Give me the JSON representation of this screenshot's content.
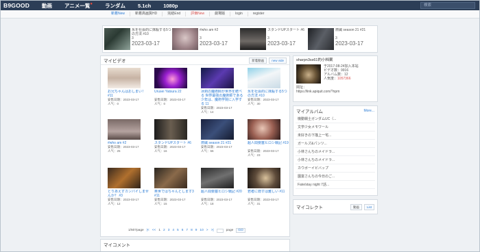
{
  "header": {
    "logo": "B9GOOD",
    "nav": [
      "動画",
      "アニメ一覧",
      "ランダム",
      "5.1ch",
      "1080p"
    ],
    "nav_dot": "●",
    "search_placeholder": "検索"
  },
  "subnav": [
    {
      "label": "新着New",
      "style": "blue"
    },
    {
      "label": "新着高画質HD",
      "style": "normal"
    },
    {
      "label": "完結End",
      "style": "normal"
    },
    {
      "label": "評価New",
      "style": "red"
    },
    {
      "label": "劇場版",
      "style": "normal"
    },
    {
      "label": "login",
      "style": "normal"
    },
    {
      "label": "register",
      "style": "normal"
    }
  ],
  "featured": [
    {
      "title": "氷を社会的に抹殺する5つの方法 #10",
      "views": "3",
      "date": "2023-03-17",
      "thumb": "t1"
    },
    {
      "title": "#who am #2",
      "views": "3",
      "date": "2023-03-17",
      "thumb": "t2"
    },
    {
      "title": "スタンドUPスタート #6",
      "views": "3",
      "date": "2023-03-17",
      "thumb": "t3"
    },
    {
      "title": "燃緘 season 21 #21",
      "views": "3",
      "date": "2023-03-17",
      "thumb": "t4"
    }
  ],
  "my_videos": {
    "heading": "マイビデオ",
    "btn_new": "新着動画",
    "btn_view": "new vide",
    "items": [
      {
        "title": "お兄ちゃんはおしまい！ #11",
        "date": "安售日期：2023-03-17",
        "pop": "人气：0",
        "thumb": "v1"
      },
      {
        "title": "Urusei Yatsura 22",
        "date": "安售日期：2023-03-17",
        "pop": "人气：0",
        "thumb": "v2"
      },
      {
        "title": "冰剣の魔術師が世界を統べる 世界最強の魔術師である少年は、魔術学院に入学する 11",
        "date": "安售日期：2023-03-17",
        "pop": "人气：14",
        "thumb": "v3"
      },
      {
        "title": "氷を社会的に抹殺する5つの方法 #10",
        "date": "安售日期：2023-03-17",
        "pop": "人气：30",
        "thumb": "v4"
      },
      {
        "title": "#who am #2",
        "date": "安售日期：2023-03-17",
        "pop": "人气：25",
        "thumb": "v5"
      },
      {
        "title": "スタンドUPスタート #6",
        "date": "安售日期：2023-03-17",
        "pop": "人气：16",
        "thumb": "v6"
      },
      {
        "title": "燃緘 season 21 #21",
        "date": "安售日期：2023-03-17",
        "pop": "人气：66",
        "thumb": "v7"
      },
      {
        "title": "超人間要塞ヒロシ戦記 #19",
        "date": "安售日期：2023-03-17",
        "pop": "人气：23",
        "thumb": "v8"
      },
      {
        "title": "とりあえずカンパイしませんか？ #3",
        "date": "安售日期：2023-03-17",
        "pop": "人气：12",
        "thumb": "v9"
      },
      {
        "title": "英世ではちゃんとします3 #11",
        "date": "安售日期：2023-03-17",
        "pop": "人气：15",
        "thumb": "v10"
      },
      {
        "title": "超人間要塞ヒロシ戦記 #20",
        "date": "安售日期：2023-03-17",
        "pop": "人气：18",
        "thumb": "v11"
      },
      {
        "title": "若者に隠すは難しい #11",
        "date": "安售日期：2023-03-17",
        "pop": "人气：31",
        "thumb": "v12"
      }
    ]
  },
  "pager": {
    "info": "1/507page",
    "first": "|<",
    "prev": "<<",
    "pages": [
      "1",
      "2",
      "3",
      "4",
      "5",
      "6",
      "7",
      "8",
      "9",
      "10"
    ],
    "next": ">",
    "last": ">|",
    "page_label": "page",
    "go": "GO"
  },
  "profile": {
    "name": "sharpn3ss61的小档案",
    "joined": "于2017-08-24加入本站",
    "videos": "ビデオ数：9916",
    "albums": "アルバム数：12",
    "popularity_label": "人気度：",
    "popularity_value": "1057366",
    "url_label": "网址：",
    "url": "https://link.apiquit.com/?npm"
  },
  "albums": {
    "heading": "マイアルバム",
    "more": "More...",
    "items": [
      "機動戦士ガンダムUC（...",
      "文学少女メモワール",
      "未好きの下描上一宅...",
      "ガールズ&パンツ...",
      "小林さんちのメイドラ...",
      "小林さんちのメイドラ...",
      "カウボーイビバップ",
      "園富さんちの今日のご...",
      "Fate/stay night 7話..."
    ]
  },
  "collect": {
    "heading": "マイコレクト",
    "tab1": "動画",
    "tab2": "List"
  },
  "comments": {
    "heading": "マイコメント"
  }
}
